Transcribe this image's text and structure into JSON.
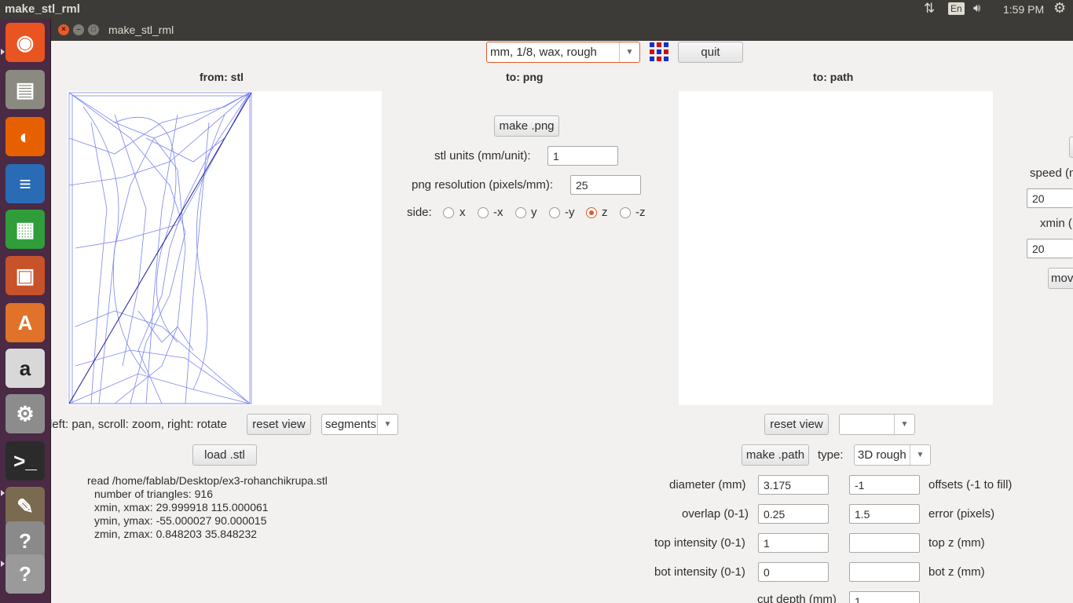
{
  "top_panel": {
    "app_title": "make_stl_rml",
    "language": "En",
    "time": "1:59 PM",
    "icons": [
      "network-icon",
      "volume-icon",
      "system-gear-icon"
    ]
  },
  "launcher": {
    "items": [
      {
        "name": "ubuntu-dash",
        "glyph": "◉",
        "color": "#e95420"
      },
      {
        "name": "files",
        "glyph": "▤",
        "color": "#8a8a80"
      },
      {
        "name": "firefox",
        "glyph": "◐",
        "color": "#e66000"
      },
      {
        "name": "writer",
        "glyph": "≡",
        "color": "#2a6bb5"
      },
      {
        "name": "calc",
        "glyph": "▦",
        "color": "#2f9e3a"
      },
      {
        "name": "impress",
        "glyph": "▣",
        "color": "#c8522a"
      },
      {
        "name": "software-center",
        "glyph": "A",
        "color": "#e0722a"
      },
      {
        "name": "amazon",
        "glyph": "a",
        "color": "#d8d8d8"
      },
      {
        "name": "system-settings",
        "glyph": "⚙",
        "color": "#8c8c8c"
      },
      {
        "name": "terminal",
        "glyph": ">_",
        "color": "#2b2b2b"
      },
      {
        "name": "gimp",
        "glyph": "✎",
        "color": "#7a6a50"
      },
      {
        "name": "unknown-app",
        "glyph": "?",
        "color": "#8a8a8a"
      },
      {
        "name": "unknown-app-2",
        "glyph": "?",
        "color": "#9a9a9a"
      }
    ]
  },
  "window": {
    "title": "make_stl_rml"
  },
  "toolbar": {
    "process_select": "mm, 1/8, wax, rough",
    "quit_label": "quit"
  },
  "stl_panel": {
    "heading": "from: stl",
    "hint": "left: pan, scroll: zoom, right: rotate",
    "reset_view_label": "reset view",
    "render_select": "segments",
    "load_label": "load .stl",
    "info": {
      "file_line": "read /home/fablab/Desktop/ex3-rohanchikrupa.stl",
      "triangles": "number of triangles: 916",
      "x_range": "xmin, xmax: 29.999918 115.000061",
      "y_range": "ymin, ymax: -55.000027 90.000015",
      "z_range": "zmin, zmax: 0.848203 35.848232"
    }
  },
  "png_panel": {
    "heading": "to: png",
    "make_label": "make .png",
    "stl_units_label": "stl units (mm/unit):",
    "stl_units_value": "1",
    "resolution_label": "png resolution (pixels/mm):",
    "resolution_value": "25",
    "side_label": "side:",
    "sides": [
      {
        "label": "x",
        "selected": false
      },
      {
        "label": "-x",
        "selected": false
      },
      {
        "label": "y",
        "selected": false
      },
      {
        "label": "-y",
        "selected": false
      },
      {
        "label": "z",
        "selected": true
      },
      {
        "label": "-z",
        "selected": false
      }
    ]
  },
  "path_panel": {
    "heading": "to: path",
    "reset_view_label": "reset view",
    "view_select": "",
    "make_label": "make .path",
    "type_label": "type:",
    "type_value": "3D rough",
    "diameter_label": "diameter (mm)",
    "diameter_value": "3.175",
    "offsets_value": "-1",
    "offsets_label": "offsets (-1 to fill)",
    "overlap_label": "overlap (0-1)",
    "overlap_value": "0.25",
    "error_value": "1.5",
    "error_label": "error (pixels)",
    "top_intensity_label": "top intensity (0-1)",
    "top_intensity_value": "1",
    "top_z_value": "",
    "top_z_label": "top z (mm)",
    "bot_intensity_label": "bot intensity (0-1)",
    "bot_intensity_value": "0",
    "bot_z_value": "",
    "bot_z_label": "bot z (mm)",
    "cut_depth_label": "cut depth (mm)",
    "cut_depth_value": "1"
  },
  "machine_panel": {
    "speed_label": "speed (m",
    "speed_value": "20",
    "xmin_label": "xmin (",
    "xmin_value": "20",
    "move_label": "mov"
  }
}
